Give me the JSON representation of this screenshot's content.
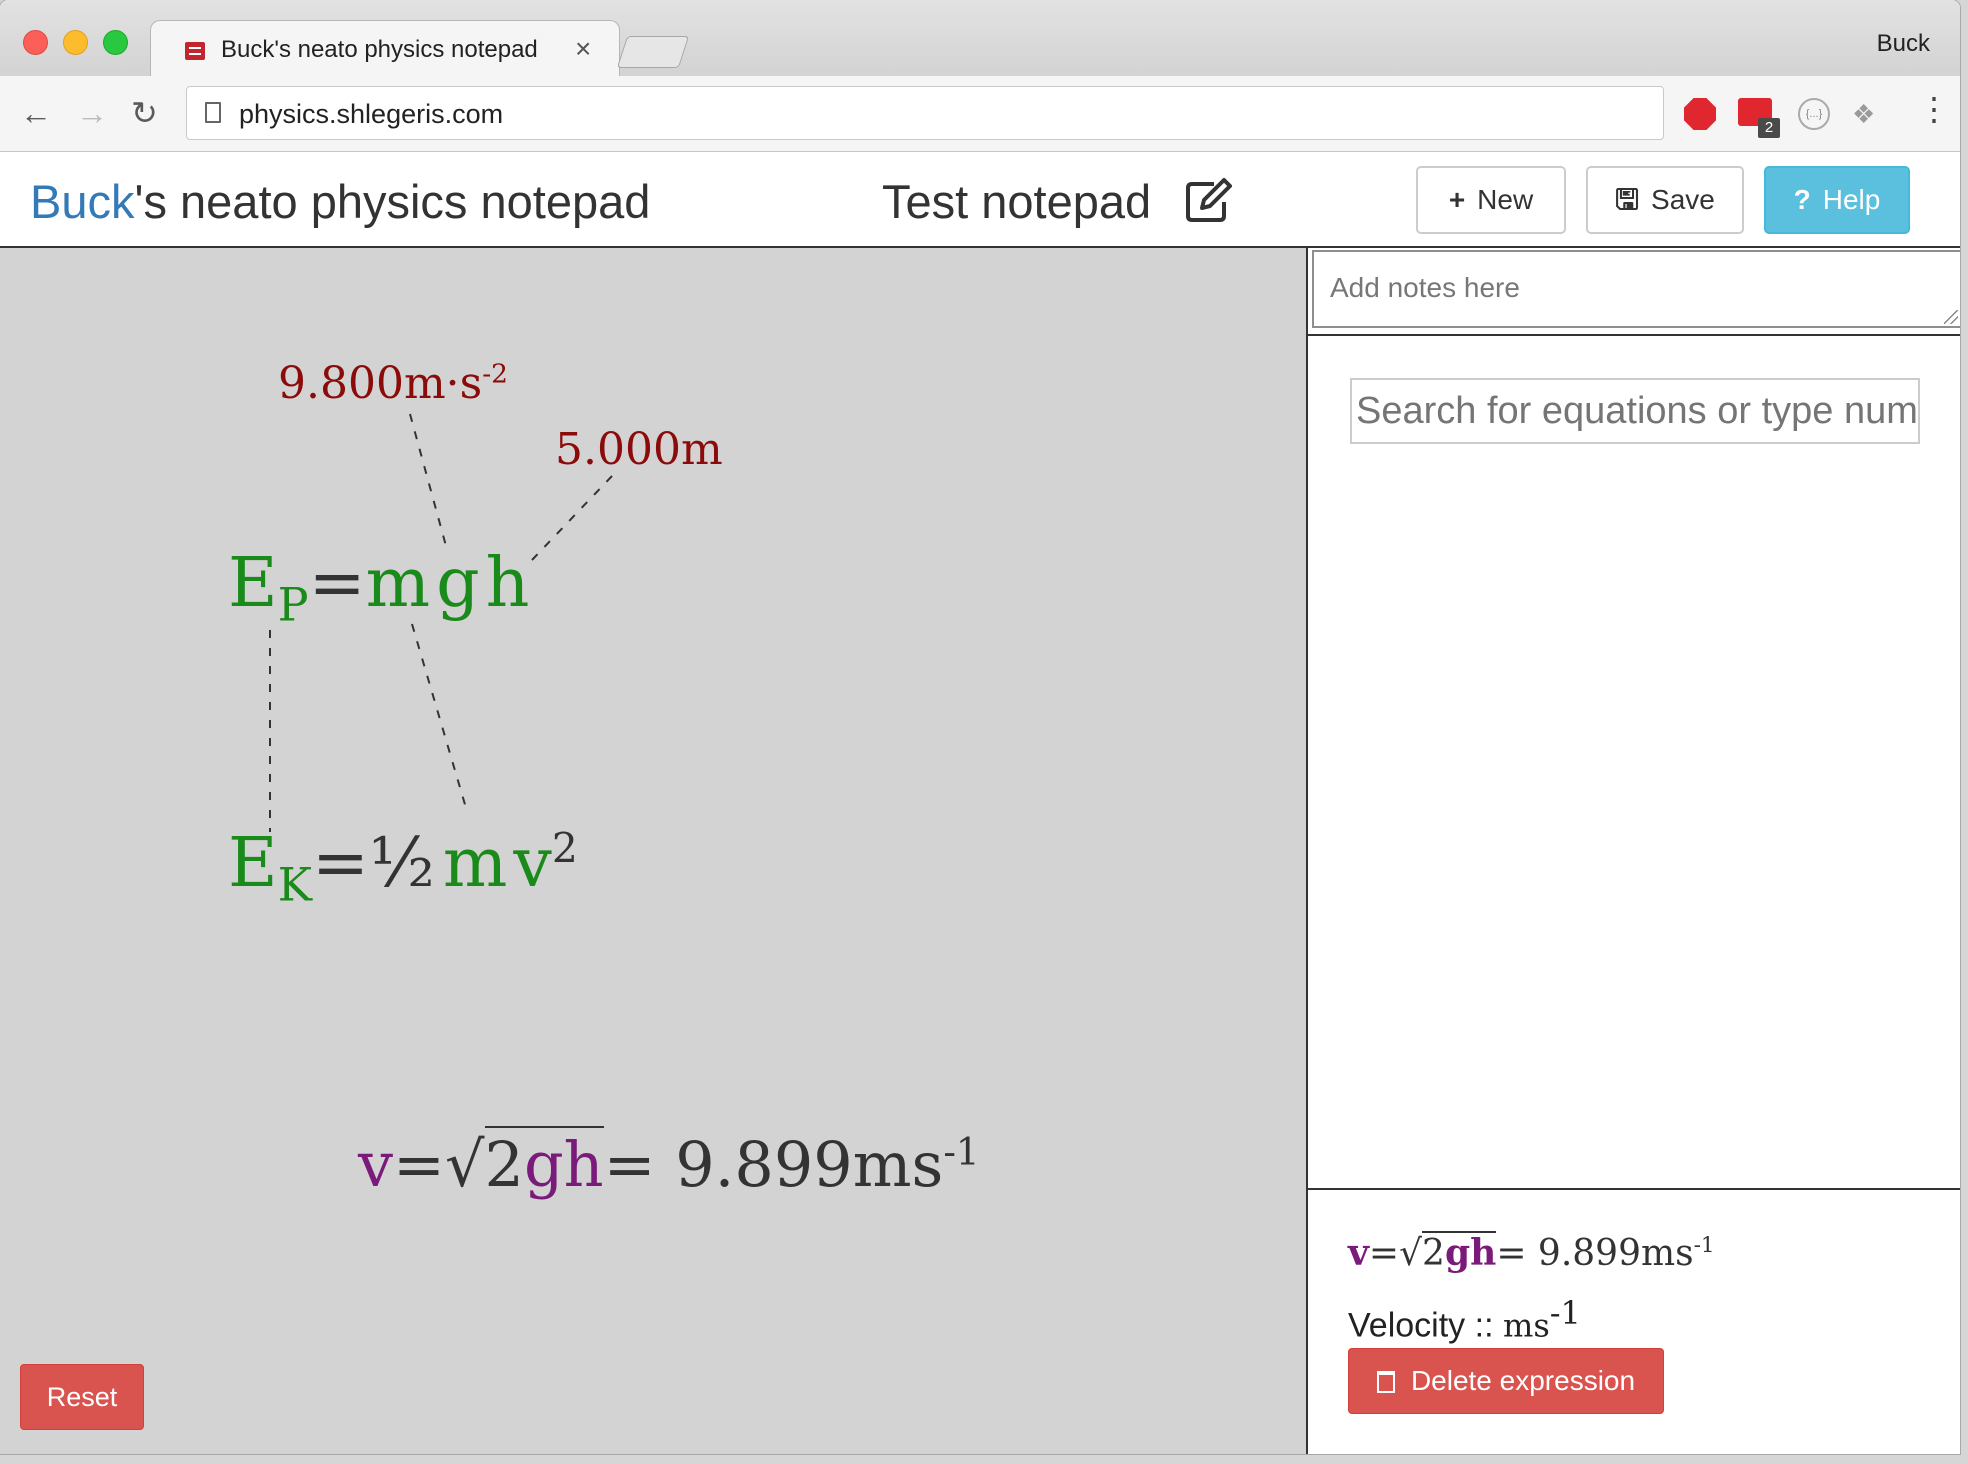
{
  "browser": {
    "tab_title": "Buck's neato physics notepad",
    "tab_close": "×",
    "profile_name": "Buck",
    "url": "physics.shlegeris.com",
    "extension_badge": "2",
    "json_ext_label": "{...}"
  },
  "header": {
    "brand_first": "Buck",
    "brand_rest": "'s neato physics notepad",
    "notepad_title": "Test notepad",
    "new_label": "New",
    "save_label": "Save",
    "help_label": "Help",
    "help_icon": "?",
    "new_icon": "+"
  },
  "canvas": {
    "g_value": "9.800m·s",
    "g_exp": "-2",
    "h_value": "5.000m",
    "eq1": {
      "lhs": "E",
      "lhs_sub": "P",
      "eq": "=",
      "m": "m",
      "g": "g",
      "h": "h"
    },
    "eq2": {
      "lhs": "E",
      "lhs_sub": "K",
      "eq": "=",
      "half": "½",
      "m": "m",
      "v": "v",
      "exp": "2"
    },
    "expr": {
      "v": "v",
      "eq": "=",
      "sqrt": "√",
      "two": "2",
      "gh": "gh",
      "result": "= 9.899ms",
      "result_exp": "-1"
    },
    "reset_label": "Reset"
  },
  "sidebar": {
    "notes_placeholder": "Add notes here",
    "search_placeholder": "Search for equations or type numbers",
    "detail": {
      "v": "v",
      "eq": "=",
      "sqrt": "√",
      "two": "2",
      "gh": "gh",
      "result": "= 9.899ms",
      "result_exp": "-1",
      "label": "Velocity :: ",
      "unit": "ms",
      "unit_exp": "-1"
    },
    "delete_label": "Delete expression"
  },
  "colors": {
    "brand_blue": "#337ab7",
    "variable_green": "#1a8a1a",
    "value_darkred": "#8b0a0a",
    "expr_purple": "#7a1a7a",
    "danger_red": "#d9534f",
    "help_cyan": "#5bc0de"
  },
  "icons": [
    "back-arrow-icon",
    "forward-arrow-icon",
    "reload-icon",
    "page-icon",
    "stop-extension-icon",
    "json-extension-icon",
    "dropbox-icon",
    "menu-icon",
    "edit-icon",
    "plus-icon",
    "floppy-icon",
    "question-icon",
    "trash-icon"
  ]
}
